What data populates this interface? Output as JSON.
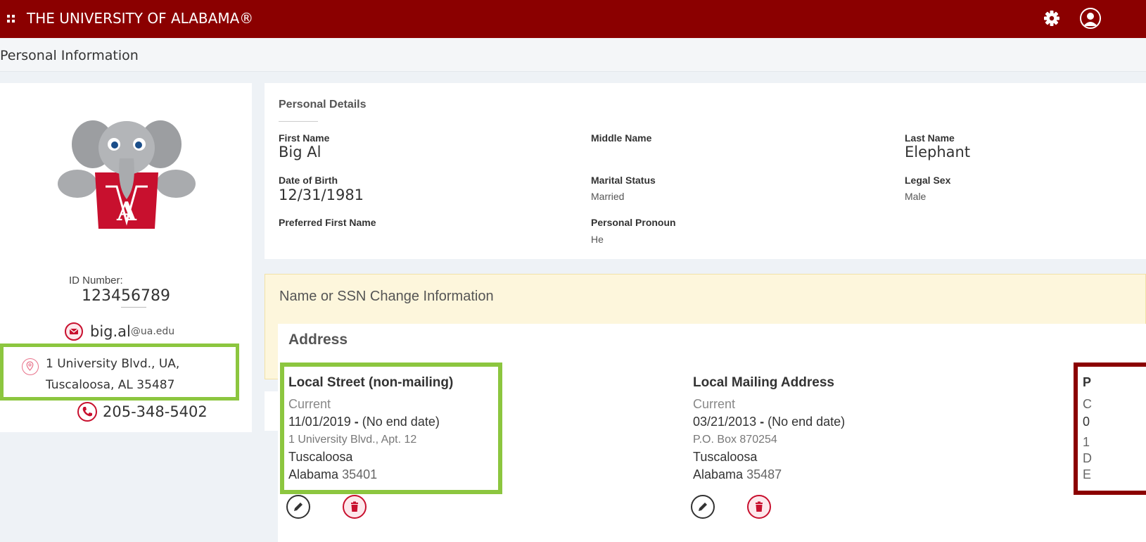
{
  "header": {
    "brand": "THE UNIVERSITY OF ALABAMA®",
    "brand_color": "#8b0000"
  },
  "page": {
    "title": "Personal Information"
  },
  "profile": {
    "id_label": "ID Number:",
    "id_value": "123456789",
    "email_user": "big.al",
    "email_domain": "@ua.edu",
    "address_line1": "1 University Blvd., UA,",
    "address_line2": "Tuscaloosa, AL 35487",
    "phone": "205-348-5402"
  },
  "personal_details": {
    "title": "Personal Details",
    "first_name_label": "First Name",
    "first_name": "Big Al",
    "middle_name_label": "Middle Name",
    "last_name_label": "Last Name",
    "last_name": "Elephant",
    "dob_label": "Date of Birth",
    "dob": "12/31/1981",
    "marital_label": "Marital Status",
    "marital": "Married",
    "legal_sex_label": "Legal Sex",
    "legal_sex": "Male",
    "preferred_label": "Preferred First Name",
    "pronoun_label": "Personal Pronoun",
    "pronoun": "He"
  },
  "name_change": {
    "title": "Name or SSN Change Information"
  },
  "address": {
    "title": "Address",
    "cards": [
      {
        "heading": "Local Street (non-mailing)",
        "status": "Current",
        "start": "11/01/2019",
        "sep": " - ",
        "end": "(No end date)",
        "street": "1 University Blvd., Apt. 12",
        "city": "Tuscaloosa",
        "state": "Alabama",
        "zip": "35401"
      },
      {
        "heading": "Local Mailing Address",
        "status": "Current",
        "start": "03/21/2013",
        "sep": " - ",
        "end": "(No end date)",
        "street": "P.O. Box 870254",
        "city": "Tuscaloosa",
        "state": "Alabama",
        "zip": "35487"
      }
    ],
    "partial_card": {
      "heading": "P",
      "status": "C",
      "date": "0",
      "street": "1",
      "city": "D",
      "state": "E"
    }
  },
  "icons": {
    "grid": "apps-grid-icon",
    "gear": "gear-icon",
    "user": "user-icon",
    "email": "envelope-icon",
    "location": "location-pin-icon",
    "phone": "phone-icon",
    "edit": "pencil-icon",
    "delete": "trash-icon"
  },
  "highlight_colors": {
    "green": "#8cc63f",
    "red": "#8b0000"
  }
}
